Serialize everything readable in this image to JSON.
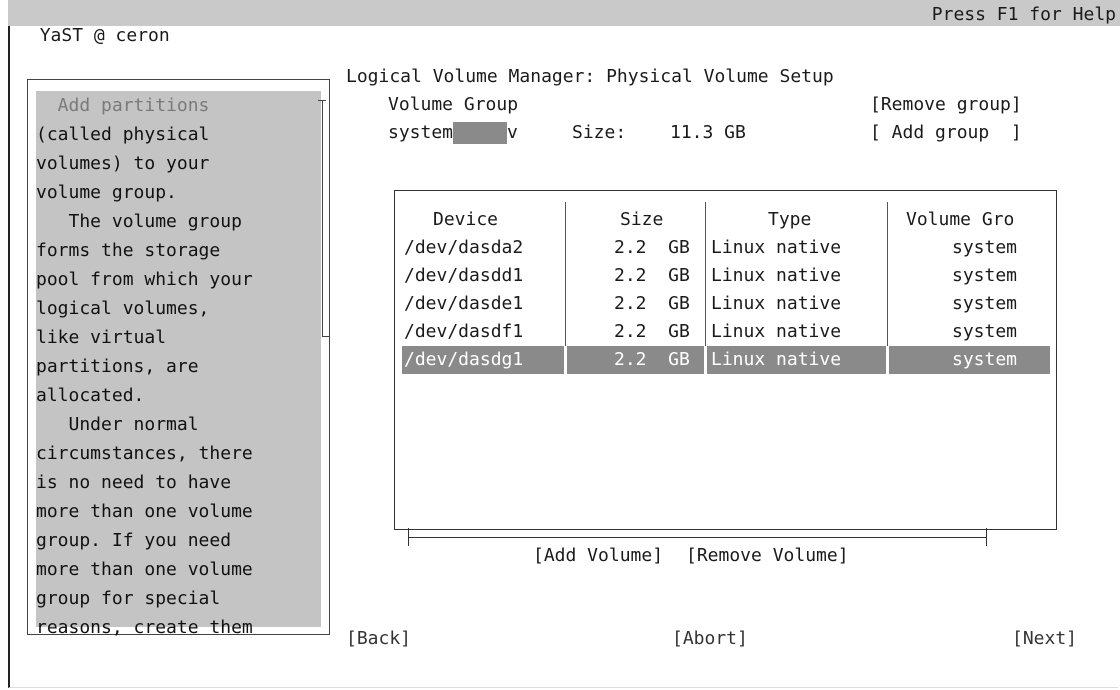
{
  "window": {
    "title": "YaST @ ceron",
    "help_hint": "Press F1 for Help"
  },
  "dialog": {
    "heading": "Logical Volume Manager: Physical Volume Setup",
    "volume_group_label": "Volume Group",
    "volume_group_value": "system",
    "volume_group_trail": "v",
    "size_label": "Size:",
    "size_value": "11.3 GB",
    "remove_group_button": "[Remove group]",
    "add_group_button": "[ Add group  ]"
  },
  "help": {
    "lines": [
      "  Add partitions",
      "(called physical",
      "volumes) to your",
      "volume group.",
      "   The volume group",
      "forms the storage",
      "pool from which your",
      "logical volumes,",
      "like virtual",
      "partitions, are",
      "allocated.",
      "   Under normal",
      "circumstances, there",
      "is no need to have",
      "more than one volume",
      "group. If you need",
      "more than one volume",
      "group for special",
      "reasons, create them"
    ]
  },
  "table": {
    "headers": [
      "Device",
      "Size",
      "Type",
      "Volume Gro"
    ],
    "rows": [
      {
        "device": "/dev/dasda2",
        "size": "2.2  GB",
        "type": "Linux native",
        "group": "system"
      },
      {
        "device": "/dev/dasdd1",
        "size": "2.2  GB",
        "type": "Linux native",
        "group": "system"
      },
      {
        "device": "/dev/dasde1",
        "size": "2.2  GB",
        "type": "Linux native",
        "group": "system"
      },
      {
        "device": "/dev/dasdf1",
        "size": "2.2  GB",
        "type": "Linux native",
        "group": "system"
      },
      {
        "device": "/dev/dasdg1",
        "size": "2.2  GB",
        "type": "Linux native",
        "group": "system"
      }
    ],
    "selected_row": 4,
    "add_volume_button": "[Add Volume]",
    "remove_volume_button": "[Remove Volume]"
  },
  "footer": {
    "back_button": "[Back]",
    "abort_button": "[Abort]",
    "next_button": "[Next]"
  },
  "colors": {
    "title_bar": "#c9c9c9",
    "help_background": "#c4c4c4",
    "selection": "#8a8a8a"
  }
}
